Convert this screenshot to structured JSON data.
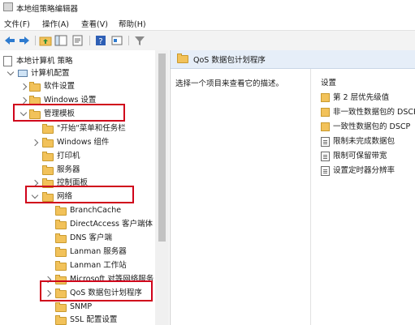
{
  "window": {
    "title": "本地组策略编辑器"
  },
  "menu": [
    "文件(F)",
    "操作(A)",
    "查看(V)",
    "帮助(H)"
  ],
  "toolbar": {
    "icons": [
      "back-arrow-icon",
      "forward-arrow-icon",
      "up-folder-icon",
      "show-hide-tree-icon",
      "export-list-icon",
      "help-icon",
      "properties-icon",
      "filter-icon"
    ]
  },
  "tree": {
    "root": "本地计算机 策略",
    "computer_config": "计算机配置",
    "software_settings": "软件设置",
    "windows_settings": "Windows 设置",
    "admin_templates": "管理模板",
    "start_menu": "\"开始\"菜单和任务栏",
    "windows_components": "Windows 组件",
    "printers": "打印机",
    "server": "服务器",
    "control_panel": "控制面板",
    "network": "网络",
    "branchcache": "BranchCache",
    "directaccess": "DirectAccess 客户端体",
    "dns_client": "DNS 客户端",
    "lanman_server": "Lanman 服务器",
    "lanman_workstation": "Lanman 工作站",
    "microsoft_network": "Microsoft 对等网络服务",
    "qos": "QoS 数据包计划程序",
    "snmp": "SNMP",
    "ssl": "SSL 配置设置"
  },
  "right": {
    "header": "QoS 数据包计划程序",
    "description": "选择一个项目来查看它的描述。",
    "settings_header": "设置",
    "settings": [
      {
        "label": "第 2 层优先级值",
        "icon": "folder-icon"
      },
      {
        "label": "非一致性数据包的 DSCP",
        "icon": "folder-icon"
      },
      {
        "label": "一致性数据包的 DSCP",
        "icon": "folder-icon"
      },
      {
        "label": "限制未完成数据包",
        "icon": "policy-setting-icon"
      },
      {
        "label": "限制可保留带宽",
        "icon": "policy-setting-icon"
      },
      {
        "label": "设置定时器分辨率",
        "icon": "policy-setting-icon"
      }
    ]
  },
  "colors": {
    "highlight": "#d0021b",
    "folder": "#f2c25a",
    "header_bg": "#e6eef8"
  }
}
